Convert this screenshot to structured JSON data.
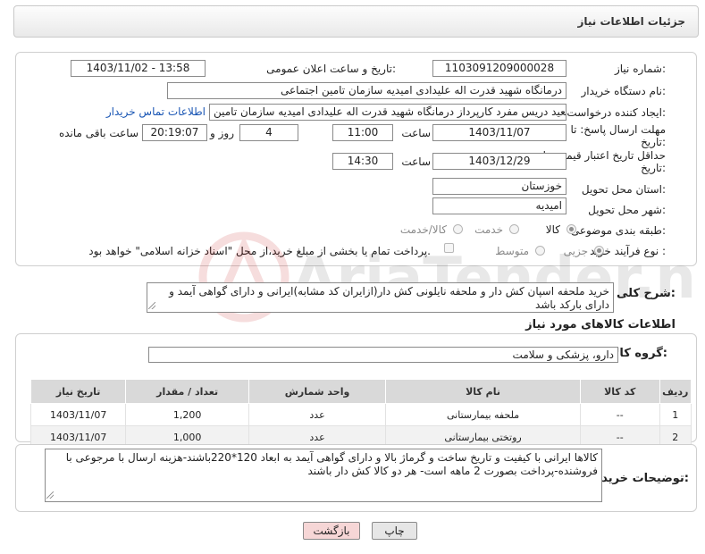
{
  "header": {
    "title": "جزئیات اطلاعات نیاز"
  },
  "form": {
    "need_number": {
      "label": "شماره نیاز:",
      "value": "1103091209000028"
    },
    "announce": {
      "label": "تاریخ و ساعت اعلان عمومی:",
      "value": "1403/11/02 - 13:58"
    },
    "buyer_org": {
      "label": "نام دستگاه خریدار:",
      "value": "درمانگاه شهید قدرت اله علیدادی امیدیه سازمان تامین اجتماعی"
    },
    "requester": {
      "label": "ایجاد کننده درخواست:",
      "value": "سعید دریس مفرد کارپرداز درمانگاه شهید قدرت اله علیدادی امیدیه سازمان تامین",
      "contact_link": "اطلاعات تماس خریدار"
    },
    "reply_deadline": {
      "label_line1": "مهلت ارسال پاسخ: تا",
      "label_line2": "تاریخ:",
      "date": "1403/11/07",
      "time_label": "ساعت",
      "time": "11:00",
      "days": "4",
      "days_label": "روز و",
      "remaining": "20:19:07",
      "remaining_label": "ساعت باقی مانده"
    },
    "price_validity": {
      "label_line1": "حداقل تاریخ اعتبار قیمت: تا",
      "label_line2": "تاریخ:",
      "date": "1403/12/29",
      "time_label": "ساعت",
      "time": "14:30"
    },
    "province": {
      "label": "استان محل تحویل:",
      "value": "خوزستان"
    },
    "city": {
      "label": "شهر محل تحویل:",
      "value": "امیدیه"
    },
    "category": {
      "label": "طبقه بندی موضوعی:",
      "options": [
        "کالا",
        "خدمت",
        "کالا/خدمت"
      ],
      "selected": "کالا"
    },
    "process": {
      "label": "نوع فرآیند خرید :",
      "options": [
        "جزیی",
        "متوسط"
      ],
      "selected": "جزیی",
      "note": "پرداخت تمام یا بخشی از مبلغ خرید،از محل \"اسناد خزانه اسلامی\" خواهد بود."
    }
  },
  "description": {
    "label": "شرح کلی نیاز:",
    "value": "خرید ملحفه اسپان کش دار و ملحفه نایلونی کش دار(ازایران کد مشابه)ایرانی و دارای گواهی آیمد و دارای بارکد باشد"
  },
  "goods": {
    "section_title": "اطلاعات کالاهای مورد نیاز",
    "group_label": "گروه کالا:",
    "group_value": "دارو، پزشکی و سلامت",
    "table": {
      "headers": [
        "ردیف",
        "کد کالا",
        "نام کالا",
        "واحد شمارش",
        "تعداد / مقدار",
        "تاریخ نیاز"
      ],
      "rows": [
        [
          "1",
          "--",
          "ملحفه بیمارستانی",
          "عدد",
          "1,200",
          "1403/11/07"
        ],
        [
          "2",
          "--",
          "روتختی بیمارستانی",
          "عدد",
          "1,000",
          "1403/11/07"
        ]
      ]
    }
  },
  "buyer_notes": {
    "label": "توضیحات خریدار:",
    "value": "کالاها ایرانی با کیفیت و تاریخ ساخت و گرماژ بالا و دارای گواهی آیمد به ابعاد 120*220باشند-هزینه ارسال با مرجوعی با فروشنده-پرداخت بصورت 2 ماهه است- هر دو کالا کش دار باشند"
  },
  "buttons": {
    "print": "چاپ",
    "back": "بازگشت"
  },
  "watermark": {
    "text": "AriaTender.neT"
  },
  "colors": {
    "link": "#1a56b4",
    "back_button_bg": "#f6d6d6",
    "print_button_bg": "#e6e6e6",
    "table_header_bg": "#d9d9d9"
  }
}
